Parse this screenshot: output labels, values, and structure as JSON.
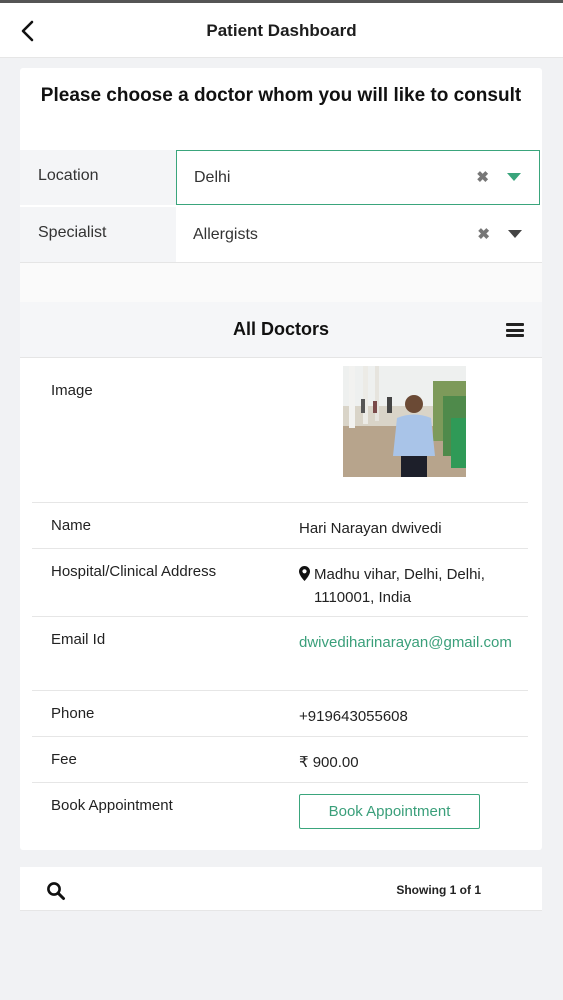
{
  "header": {
    "title": "Patient Dashboard",
    "back_icon": "chevron-left-icon"
  },
  "prompt": "Please choose a doctor whom you will like to consult",
  "filters": {
    "location": {
      "label": "Location",
      "value": "Delhi",
      "clear": "✖"
    },
    "specialist": {
      "label": "Specialist",
      "value": "Allergists",
      "clear": "✖"
    }
  },
  "table": {
    "title": "All Doctors",
    "menu_icon": "hamburger-menu-icon",
    "rows": {
      "image": {
        "label": "Image"
      },
      "name": {
        "label": "Name",
        "value": "Hari Narayan dwivedi"
      },
      "address": {
        "label": "Hospital/Clinical Address",
        "value": "Madhu vihar, Delhi, Delhi, 1110001, India"
      },
      "email": {
        "label": "Email Id",
        "value": "dwivediharinarayan@gmail.com"
      },
      "phone": {
        "label": "Phone",
        "value": "+919643055608"
      },
      "fee": {
        "label": "Fee",
        "value": "₹ 900.00"
      },
      "book": {
        "label": "Book Appointment",
        "button": "Book Appointment"
      }
    }
  },
  "footer": {
    "showing": "Showing 1 of 1",
    "search_icon": "search-icon"
  },
  "colors": {
    "accent": "#3aa57c",
    "background": "#f1f2f4"
  }
}
